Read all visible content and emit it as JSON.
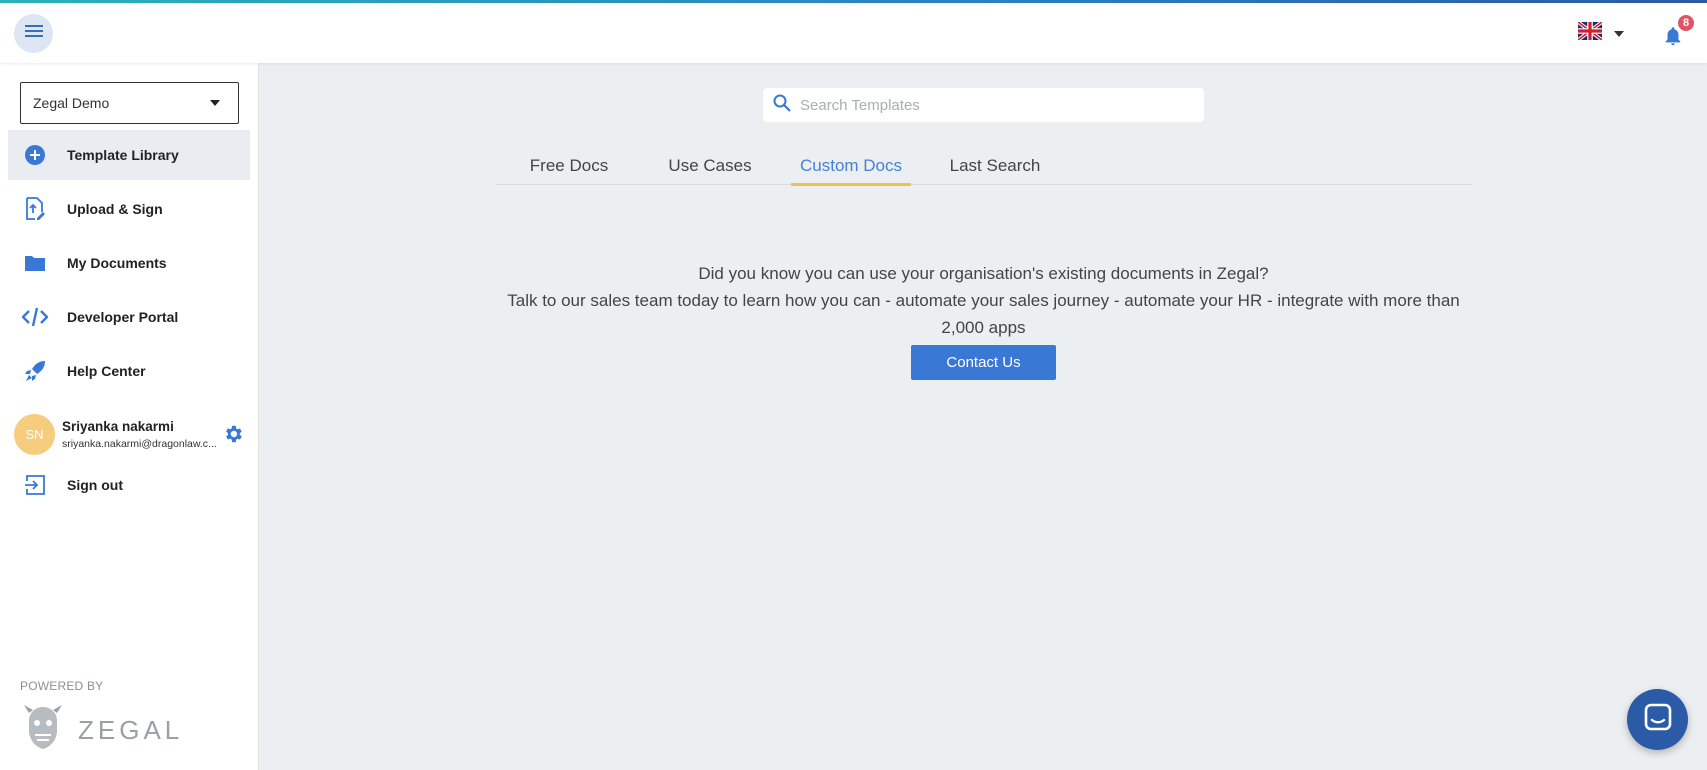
{
  "topbar": {
    "menu_icon": "hamburger-icon",
    "language_flag": "uk-flag-icon",
    "notifications_count": "8"
  },
  "sidebar": {
    "org_select_value": "Zegal Demo",
    "items": [
      {
        "label": "Template Library",
        "icon": "plus-circle-icon",
        "active": true
      },
      {
        "label": "Upload & Sign",
        "icon": "upload-sign-icon",
        "active": false
      },
      {
        "label": "My Documents",
        "icon": "folder-icon",
        "active": false
      },
      {
        "label": "Developer Portal",
        "icon": "code-icon",
        "active": false
      },
      {
        "label": "Help Center",
        "icon": "rocket-icon",
        "active": false
      }
    ],
    "user": {
      "initials": "SN",
      "name": "Sriyanka nakarmi",
      "email": "sriyanka.nakarmi@dragonlaw.c..."
    },
    "sign_out_label": "Sign out",
    "powered_by": "POWERED BY",
    "brand": "ZEGAL"
  },
  "main": {
    "search_placeholder": "Search Templates",
    "tabs": [
      {
        "label": "Free Docs",
        "active": false
      },
      {
        "label": "Use Cases",
        "active": false
      },
      {
        "label": "Custom Docs",
        "active": true
      },
      {
        "label": "Last Search",
        "active": false
      }
    ],
    "message_line1": "Did you know you can use your organisation's existing documents in Zegal?",
    "message_line2": "Talk to our sales team today to learn how you can - automate your sales journey - automate your HR - integrate with more than 2,000 apps",
    "contact_button": "Contact Us"
  },
  "colors": {
    "accent": "#3a78d6",
    "tab_underline": "#f5c04a",
    "badge": "#e05563",
    "chat": "#2b5aa6",
    "avatar": "#f6cc7e"
  }
}
